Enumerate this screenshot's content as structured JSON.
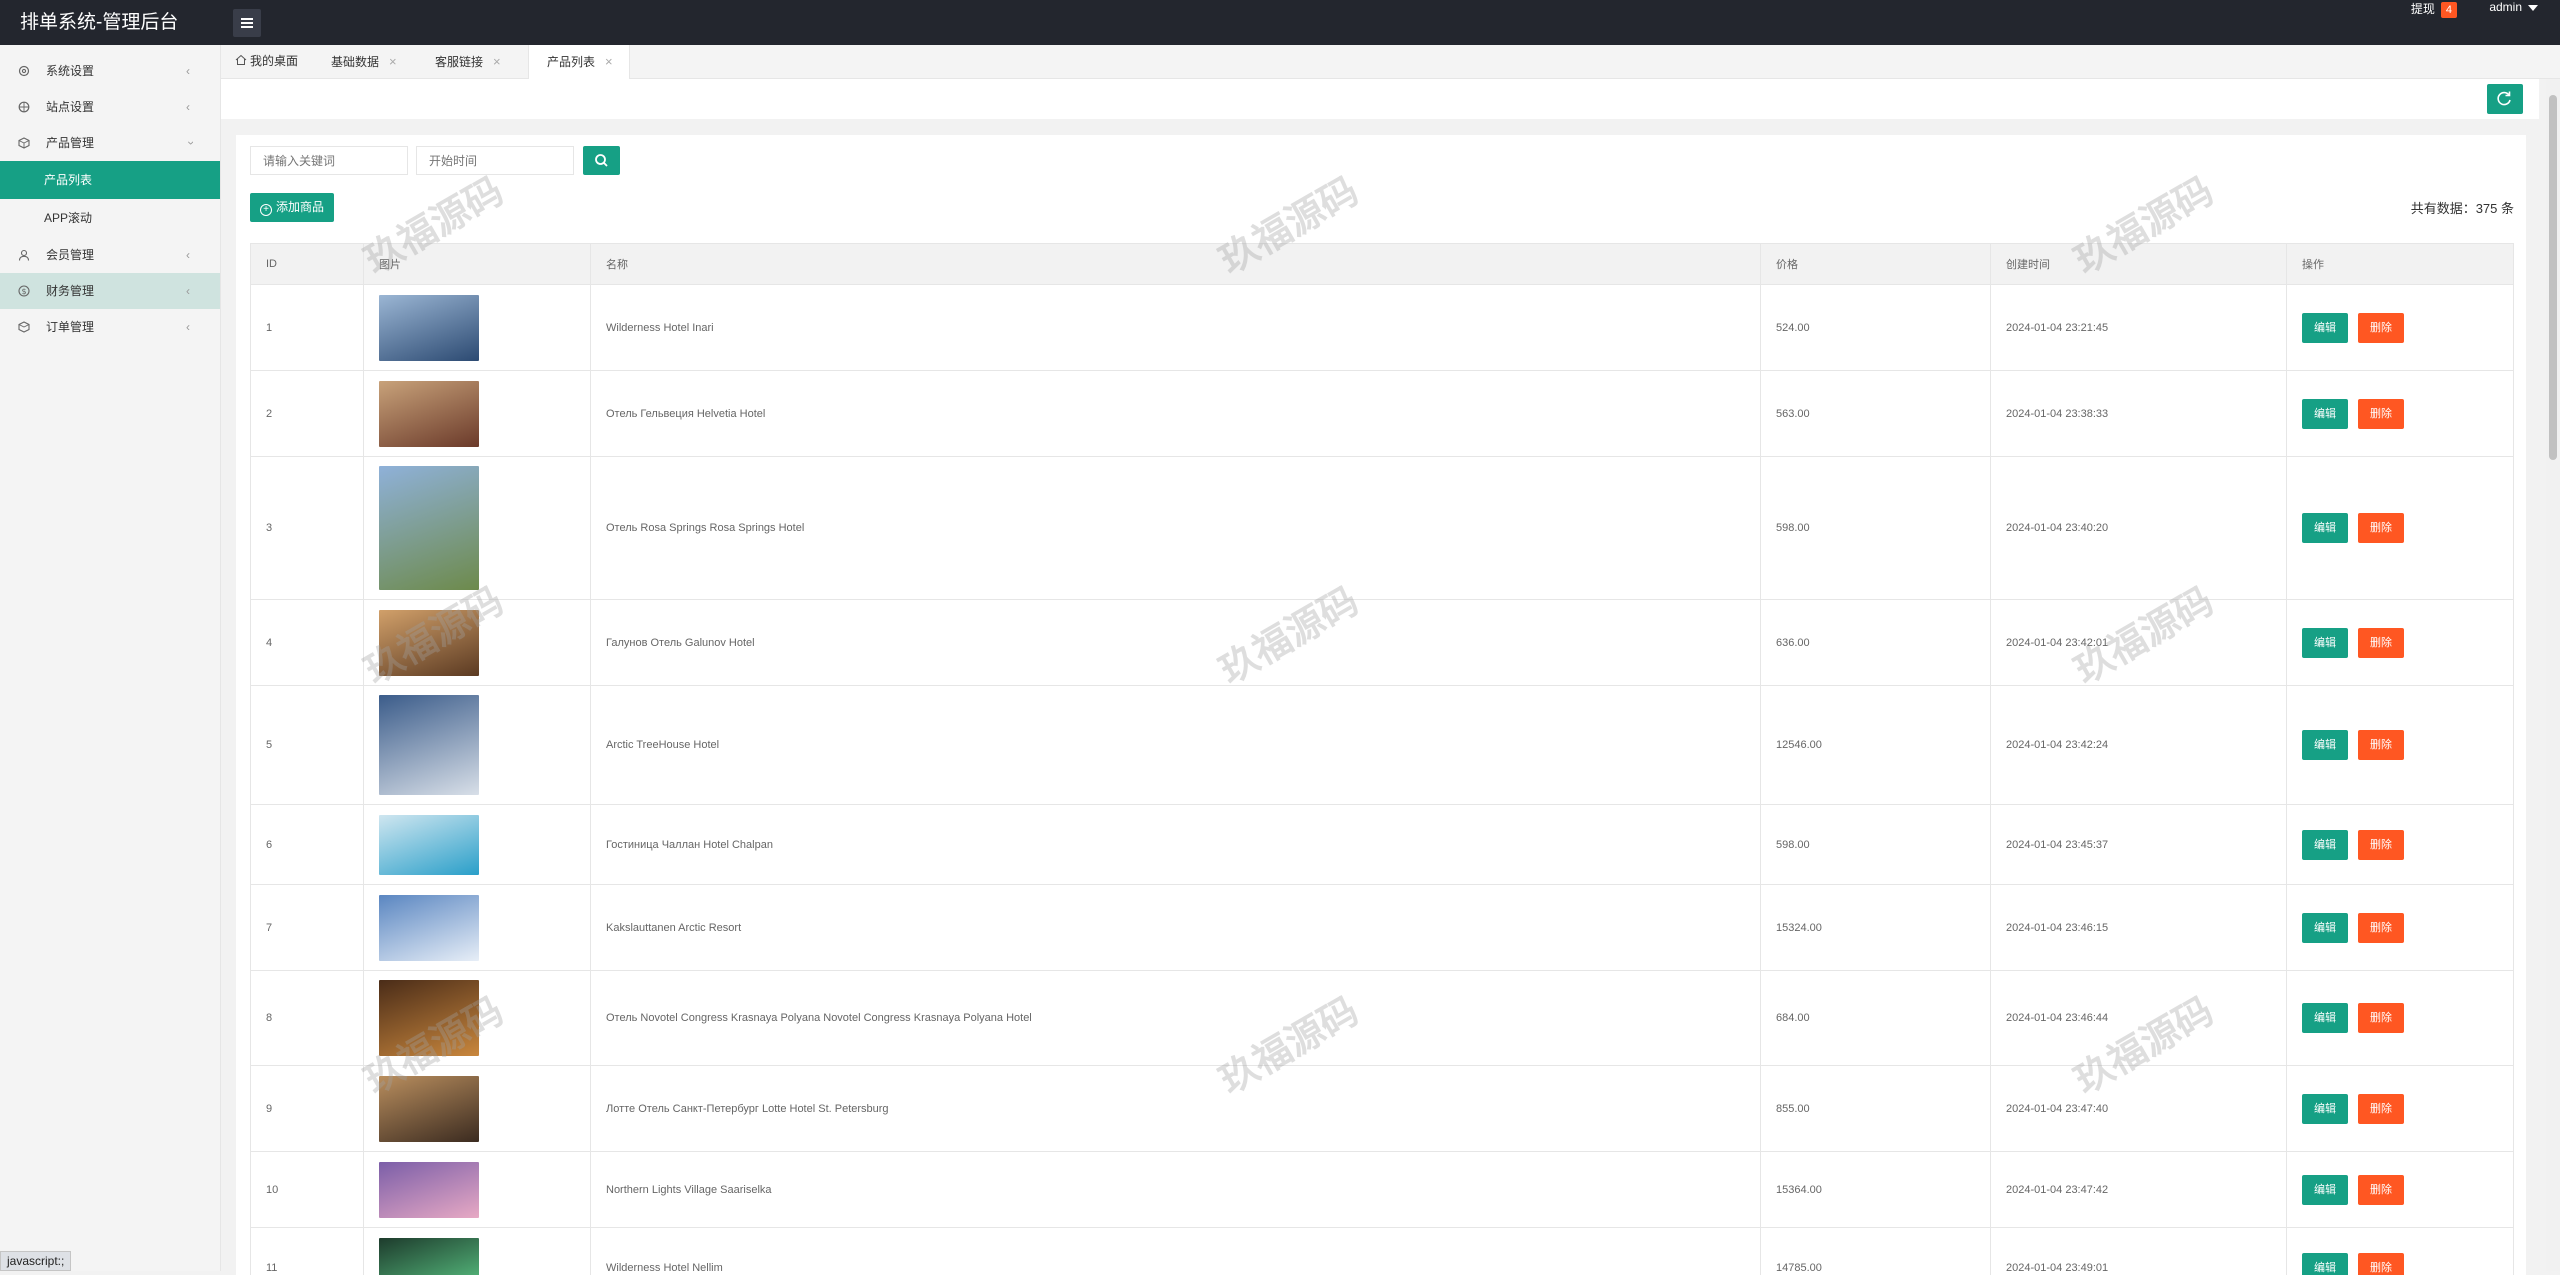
{
  "header": {
    "brand": "排单系统-管理后台",
    "withdraw_label": "提现",
    "withdraw_count": "4",
    "user": "admin"
  },
  "sidebar": {
    "items": [
      {
        "label": "系统设置",
        "icon": "gear-icon"
      },
      {
        "label": "站点设置",
        "icon": "globe-icon"
      },
      {
        "label": "产品管理",
        "icon": "box-icon"
      },
      {
        "label": "产品列表"
      },
      {
        "label": "APP滚动"
      },
      {
        "label": "会员管理",
        "icon": "user-icon"
      },
      {
        "label": "财务管理",
        "icon": "dollar-icon"
      },
      {
        "label": "订单管理",
        "icon": "order-icon"
      }
    ]
  },
  "tabs": [
    {
      "label": "我的桌面"
    },
    {
      "label": "基础数据"
    },
    {
      "label": "客服链接"
    },
    {
      "label": "产品列表"
    }
  ],
  "search": {
    "keyword_placeholder": "请输入关键词",
    "time_placeholder": "开始时间"
  },
  "toolbar": {
    "add_label": "添加商品",
    "count_text": "共有数据：375 条"
  },
  "table": {
    "headers": [
      "ID",
      "图片",
      "名称",
      "价格",
      "创建时间",
      "操作"
    ],
    "edit_label": "编辑",
    "delete_label": "删除",
    "rows": [
      {
        "id": "1",
        "name": "Wilderness Hotel Inari",
        "price": "524.00",
        "created": "2024-01-04 23:21:45",
        "img_h": 66,
        "colors": [
          "#9bb6d4",
          "#2c4a72"
        ]
      },
      {
        "id": "2",
        "name": "Отель Гельвеция Helvetia Hotel",
        "price": "563.00",
        "created": "2024-01-04 23:38:33",
        "img_h": 66,
        "colors": [
          "#c8a27a",
          "#6b3a2a"
        ]
      },
      {
        "id": "3",
        "name": "Отель Rosa Springs Rosa Springs Hotel",
        "price": "598.00",
        "created": "2024-01-04 23:40:20",
        "img_h": 124,
        "colors": [
          "#8fb1d9",
          "#6d8a4b"
        ]
      },
      {
        "id": "4",
        "name": "Галунов Отель Galunov Hotel",
        "price": "636.00",
        "created": "2024-01-04 23:42:01",
        "img_h": 66,
        "colors": [
          "#d1a06a",
          "#5b3a22"
        ]
      },
      {
        "id": "5",
        "name": "Arctic TreeHouse Hotel",
        "price": "12546.00",
        "created": "2024-01-04 23:42:24",
        "img_h": 100,
        "colors": [
          "#3b5c8a",
          "#d8dfe8"
        ]
      },
      {
        "id": "6",
        "name": "Гостиница Чаллан Hotel Chalpan",
        "price": "598.00",
        "created": "2024-01-04 23:45:37",
        "img_h": 60,
        "colors": [
          "#cfe6f0",
          "#2a9fc9"
        ]
      },
      {
        "id": "7",
        "name": "Kakslauttanen Arctic Resort",
        "price": "15324.00",
        "created": "2024-01-04 23:46:15",
        "img_h": 66,
        "colors": [
          "#5a86c1",
          "#e7eef7"
        ]
      },
      {
        "id": "8",
        "name": "Отель Novotel Congress Krasnaya Polyana Novotel Congress Krasnaya Polyana Hotel",
        "price": "684.00",
        "created": "2024-01-04 23:46:44",
        "img_h": 76,
        "colors": [
          "#4a2c18",
          "#c9873d"
        ]
      },
      {
        "id": "9",
        "name": "Лотте Отель Санкт-Петербург Lotte Hotel St. Petersburg",
        "price": "855.00",
        "created": "2024-01-04 23:47:40",
        "img_h": 66,
        "colors": [
          "#b98e5e",
          "#3b2b20"
        ]
      },
      {
        "id": "10",
        "name": "Northern Lights Village Saariselka",
        "price": "15364.00",
        "created": "2024-01-04 23:47:42",
        "img_h": 56,
        "colors": [
          "#7b5ea8",
          "#e7a9c4"
        ]
      },
      {
        "id": "11",
        "name": "Wilderness Hotel Nellim",
        "price": "14785.00",
        "created": "2024-01-04 23:49:01",
        "img_h": 60,
        "colors": [
          "#1d3b2c",
          "#5fcf8a"
        ]
      }
    ]
  },
  "watermark": "玖福源码",
  "status_bar": "javascript:;",
  "accent_color": "#16a085",
  "danger_color": "#ff5722"
}
